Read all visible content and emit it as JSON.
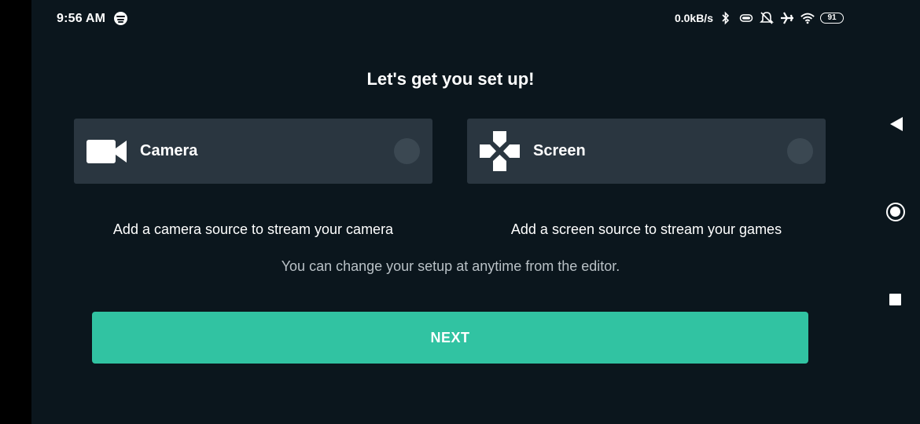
{
  "status_bar": {
    "time": "9:56 AM",
    "network_speed": "0.0kB/s",
    "battery_level": "91",
    "icons": [
      "spotify-icon",
      "bluetooth-icon",
      "vibrate-icon",
      "alarm-off-icon",
      "airplane-icon",
      "wifi-icon",
      "battery-icon"
    ]
  },
  "setup": {
    "title": "Let's get you set up!",
    "options": [
      {
        "label": "Camera",
        "icon": "video-camera-icon",
        "description": "Add a camera source to stream your camera",
        "selected": false
      },
      {
        "label": "Screen",
        "icon": "gamepad-icon",
        "description": "Add a screen source to stream your games",
        "selected": false
      }
    ],
    "note": "You can change your setup at anytime from the editor.",
    "next_label": "NEXT"
  },
  "colors": {
    "background": "#0b161d",
    "card": "#2a3640",
    "accent": "#31c3a2"
  },
  "navigation": [
    "back-icon",
    "home-icon",
    "recents-icon"
  ]
}
